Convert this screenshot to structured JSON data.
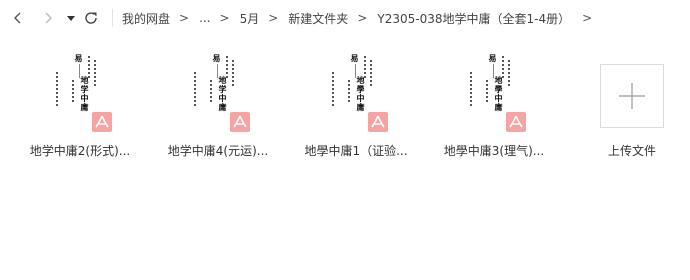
{
  "nav": {
    "back_icon": "chevron-left-icon",
    "forward_icon": "chevron-right-icon",
    "history_icon": "caret-down-icon",
    "refresh_icon": "refresh-icon"
  },
  "breadcrumb": {
    "items": [
      {
        "label": "我的网盘"
      },
      {
        "label": "..."
      },
      {
        "label": "5月"
      },
      {
        "label": "新建文件夹"
      },
      {
        "label": "Y2305-038地学中庸（全套1-4册）"
      }
    ],
    "separator": ">"
  },
  "files": [
    {
      "name": "地学中庸2(形式)...",
      "type": "pdf"
    },
    {
      "name": "地学中庸4(元运)...",
      "type": "pdf"
    },
    {
      "name": "地學中庸1（证验...",
      "type": "pdf"
    },
    {
      "name": "地學中庸3(理气)...",
      "type": "pdf"
    }
  ],
  "upload": {
    "label": "上传文件",
    "icon": "plus-icon"
  },
  "colors": {
    "pdf_badge": "#f5a3a3",
    "text": "#333333"
  }
}
